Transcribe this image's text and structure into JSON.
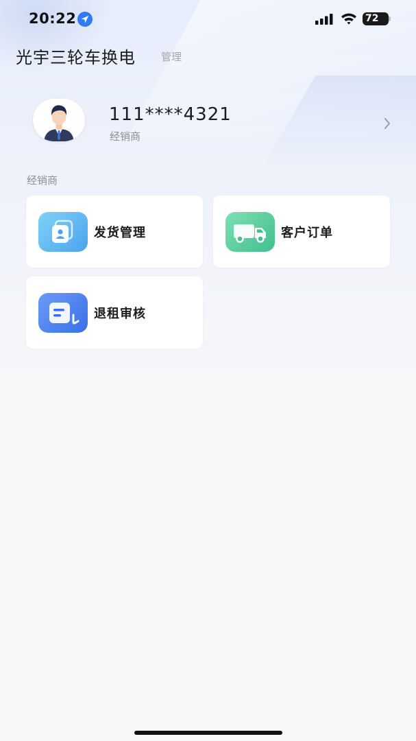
{
  "status_bar": {
    "time": "20:22",
    "battery": "72",
    "icons": [
      "location-arrow-icon",
      "cellular-signal-icon",
      "wifi-icon",
      "battery-icon"
    ]
  },
  "header": {
    "title": "光宇三轮车换电",
    "subtitle": "管理"
  },
  "profile": {
    "phone": "111****4321",
    "role": "经销商",
    "avatar_icon": "businessman-avatar-icon",
    "chevron_icon": "chevron-right-icon"
  },
  "section": {
    "label": "经销商"
  },
  "menu": [
    {
      "label": "发货管理",
      "icon": "shipping-card-icon",
      "color": "#4aa3ef"
    },
    {
      "label": "客户订单",
      "icon": "delivery-truck-icon",
      "color": "#3fbf8c"
    },
    {
      "label": "退租审核",
      "icon": "document-review-icon",
      "color": "#3b6fe8"
    }
  ],
  "colors": {
    "background_top": "#e6edfb",
    "background_bottom": "#f8f8f9",
    "card": "#ffffff",
    "text_primary": "#1c1c1e",
    "text_secondary": "#8e9097"
  }
}
